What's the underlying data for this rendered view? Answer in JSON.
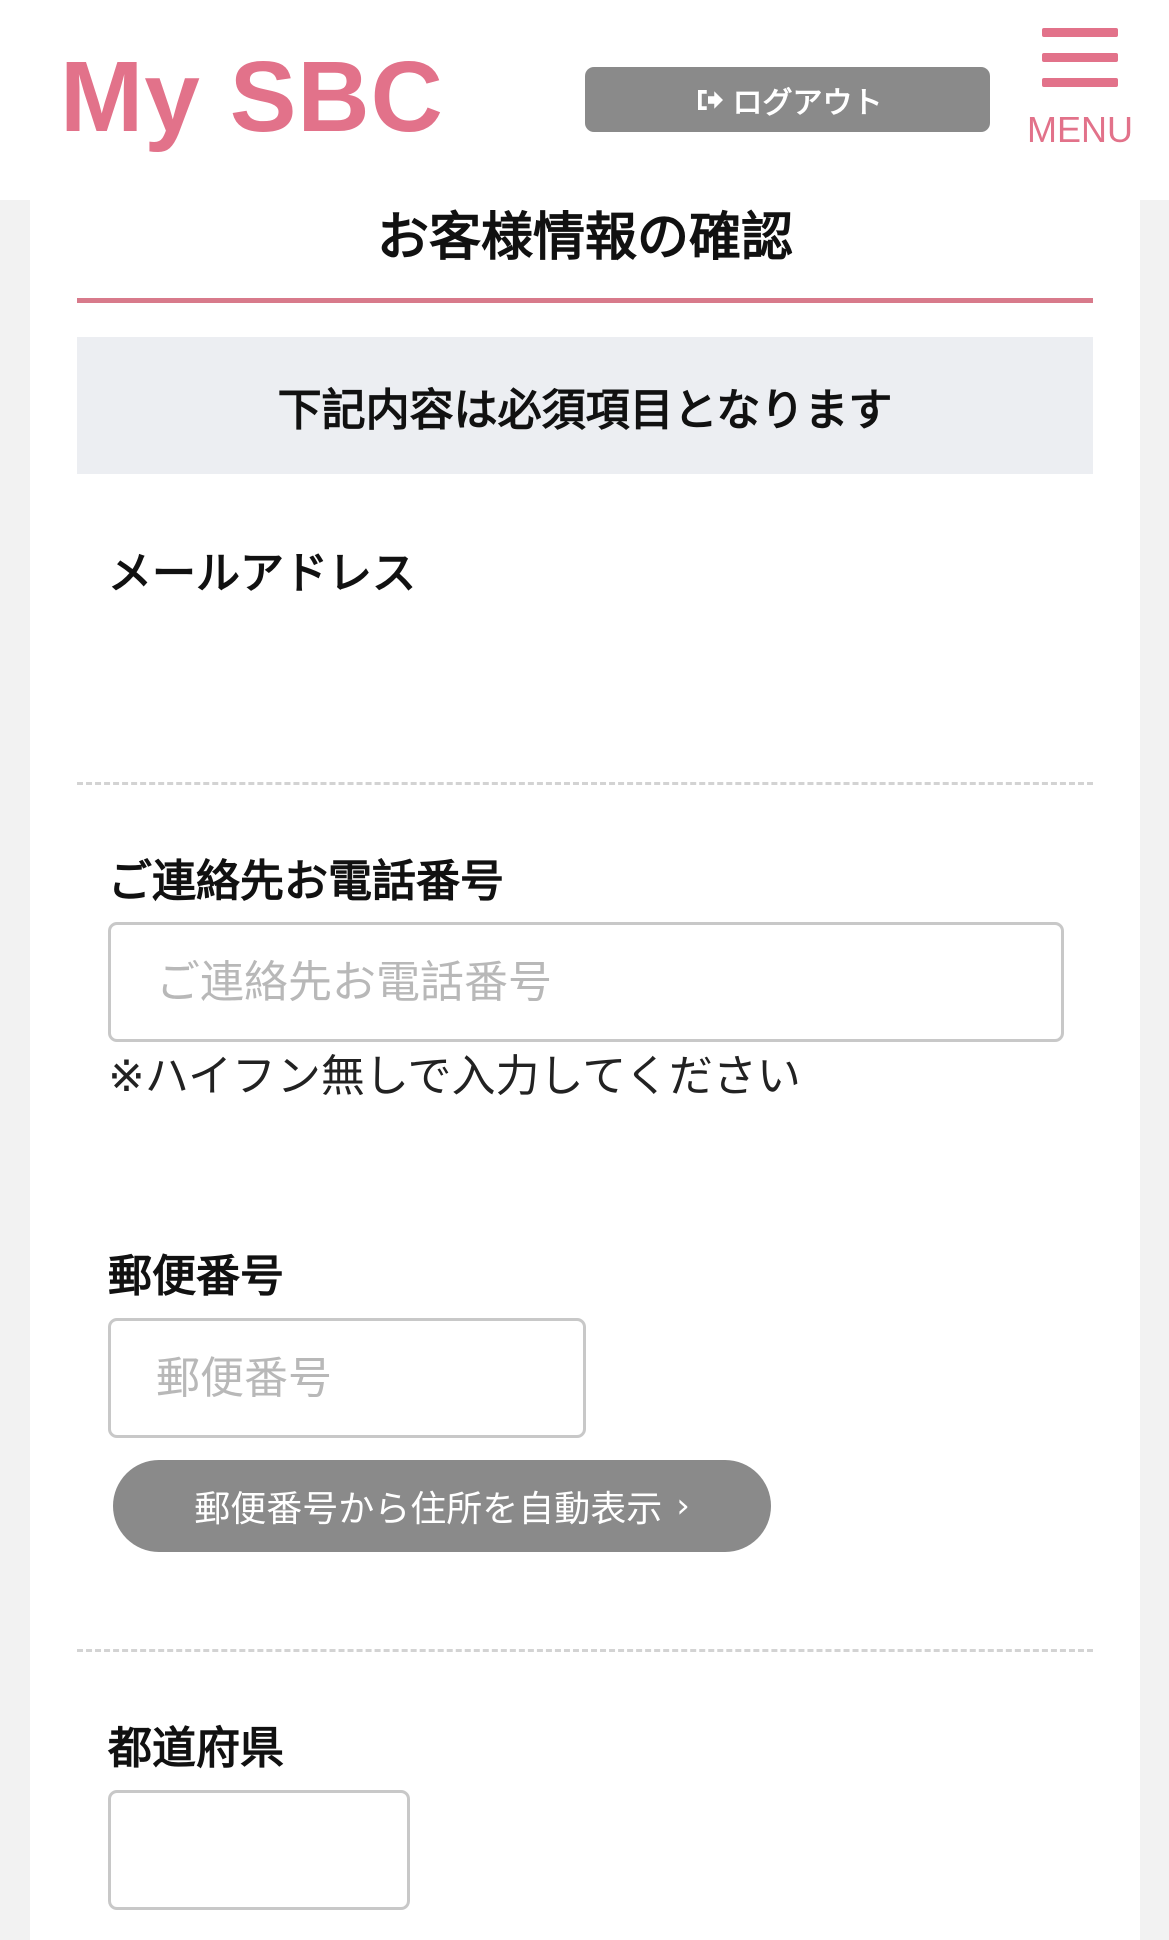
{
  "header": {
    "logo": "My SBC",
    "logout_label": "ログアウト",
    "menu_label": "MENU",
    "brand_color": "#e2728a"
  },
  "page": {
    "title": "お客様情報の確認",
    "notice": "下記内容は必須項目となります"
  },
  "fields": {
    "email": {
      "label": "メールアドレス",
      "value": ""
    },
    "phone": {
      "label": "ご連絡先お電話番号",
      "placeholder": "ご連絡先お電話番号",
      "value": "",
      "hint": "※ハイフン無しで入力してください"
    },
    "postal": {
      "label": "郵便番号",
      "placeholder": "郵便番号",
      "value": "",
      "auto_button": "郵便番号から住所を自動表示"
    },
    "prefecture": {
      "label": "都道府県",
      "value": ""
    }
  }
}
